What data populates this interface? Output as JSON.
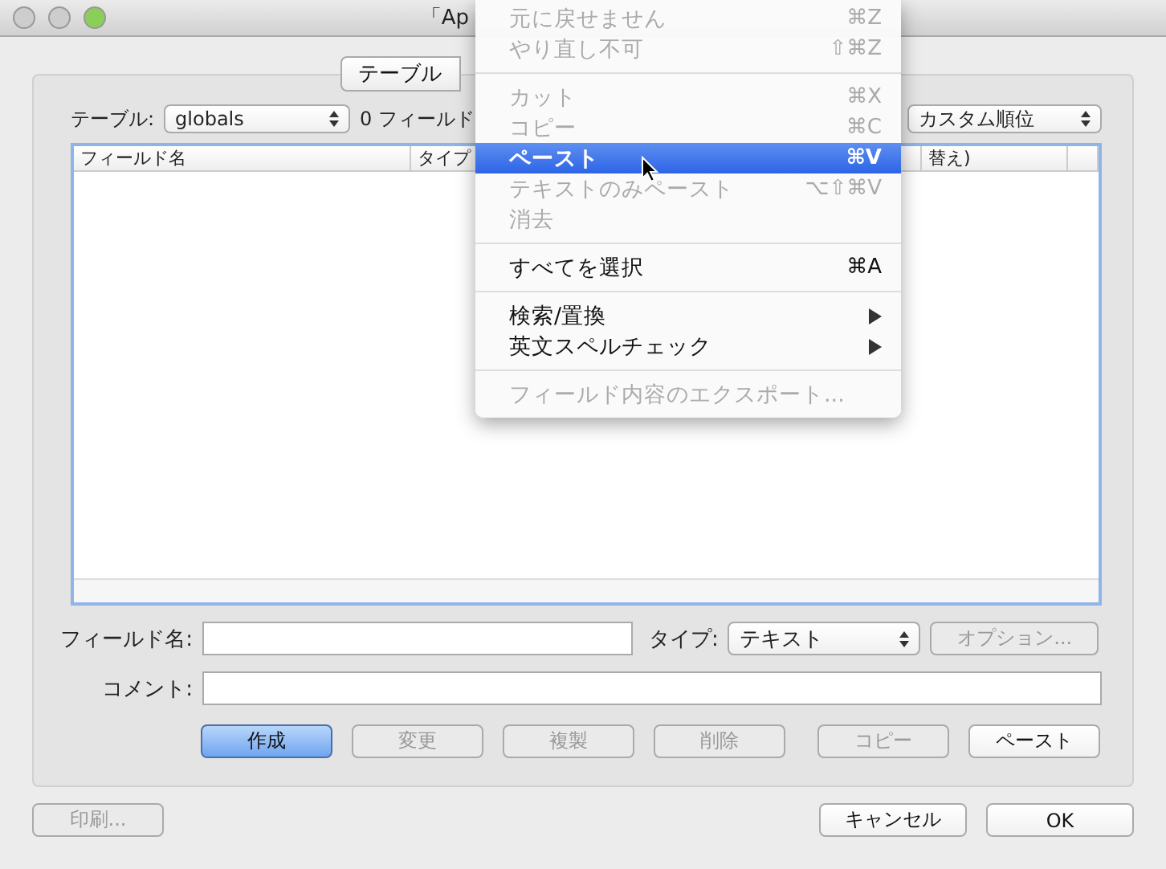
{
  "window": {
    "title": "「Ap"
  },
  "tabs": [
    {
      "label": "テーブル",
      "selected": false
    }
  ],
  "table_selector": {
    "label": "テーブル:",
    "value": "globals",
    "field_count": "0 フィールド"
  },
  "sort_popup": {
    "value": "カスタム順位"
  },
  "table": {
    "columns": [
      "フィールド名",
      "タイプ",
      "替え)"
    ]
  },
  "field_name": {
    "label": "フィールド名:"
  },
  "type": {
    "label": "タイプ:",
    "value": "テキスト"
  },
  "options_button": {
    "label": "オプション...",
    "disabled": true
  },
  "comment": {
    "label": "コメント:"
  },
  "action_buttons": [
    {
      "label": "作成",
      "disabled": false,
      "default": true
    },
    {
      "label": "変更",
      "disabled": true,
      "default": false
    },
    {
      "label": "複製",
      "disabled": true,
      "default": false
    },
    {
      "label": "削除",
      "disabled": true,
      "default": false
    },
    {
      "label": "コピー",
      "disabled": true,
      "default": false
    },
    {
      "label": "ペースト",
      "disabled": false,
      "default": false
    }
  ],
  "bottom_buttons": [
    {
      "label": "印刷...",
      "disabled": true
    },
    {
      "label": "キャンセル",
      "disabled": false
    },
    {
      "label": "OK",
      "disabled": false
    }
  ],
  "context_menu": [
    {
      "kind": "item",
      "label": "元に戻せません",
      "shortcut": "⌘Z",
      "disabled": true,
      "selected": false
    },
    {
      "kind": "item",
      "label": "やり直し不可",
      "shortcut": "⇧⌘Z",
      "disabled": true,
      "selected": false
    },
    {
      "kind": "separator"
    },
    {
      "kind": "item",
      "label": "カット",
      "shortcut": "⌘X",
      "disabled": true,
      "selected": false
    },
    {
      "kind": "item",
      "label": "コピー",
      "shortcut": "⌘C",
      "disabled": true,
      "selected": false
    },
    {
      "kind": "item",
      "label": "ペースト",
      "shortcut": "⌘V",
      "disabled": false,
      "selected": true
    },
    {
      "kind": "item",
      "label": "テキストのみペースト",
      "shortcut": "⌥⇧⌘V",
      "disabled": true,
      "selected": false
    },
    {
      "kind": "item",
      "label": "消去",
      "disabled": true,
      "selected": false
    },
    {
      "kind": "separator"
    },
    {
      "kind": "item",
      "label": "すべてを選択",
      "shortcut": "⌘A",
      "disabled": false,
      "selected": false
    },
    {
      "kind": "separator"
    },
    {
      "kind": "submenu",
      "label": "検索/置換",
      "disabled": false,
      "selected": false
    },
    {
      "kind": "submenu",
      "label": "英文スペルチェック",
      "disabled": false,
      "selected": false
    },
    {
      "kind": "separator"
    },
    {
      "kind": "item",
      "label": "フィールド内容のエクスポート...",
      "disabled": true,
      "selected": false
    }
  ]
}
